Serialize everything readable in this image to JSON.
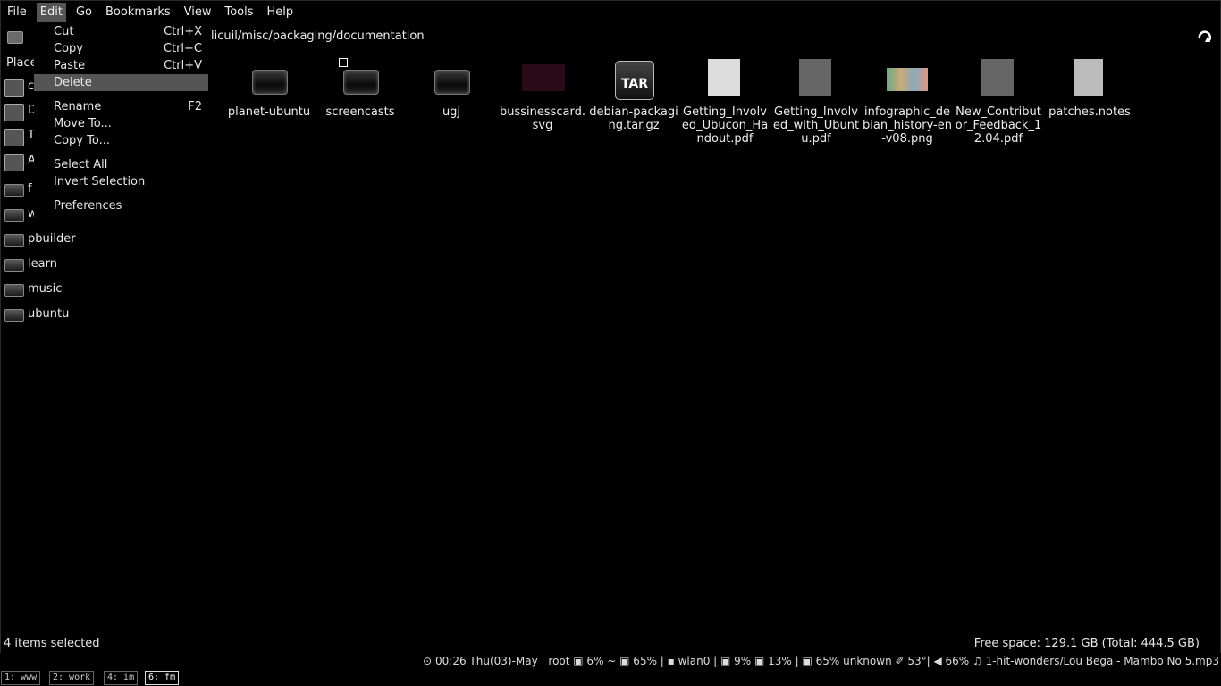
{
  "menubar": {
    "items": [
      "File",
      "Edit",
      "Go",
      "Bookmarks",
      "View",
      "Tools",
      "Help"
    ],
    "active": "Edit"
  },
  "toolbar": {
    "path": "licuil/misc/packaging/documentation"
  },
  "sidebar": {
    "places_label": "Place",
    "partial_items": [
      "c",
      "D",
      "T",
      "A",
      "f"
    ],
    "items": [
      "work",
      "pbuilder",
      "learn",
      "music",
      "ubuntu"
    ]
  },
  "edit_menu": {
    "items": [
      {
        "label": "Cut",
        "accel": "Ctrl+X"
      },
      {
        "label": "Copy",
        "accel": "Ctrl+C"
      },
      {
        "label": "Paste",
        "accel": "Ctrl+V"
      },
      {
        "label": "Delete",
        "accel": ""
      },
      {
        "label": "Rename",
        "accel": "F2"
      },
      {
        "label": "Move To...",
        "accel": ""
      },
      {
        "label": "Copy To...",
        "accel": ""
      },
      {
        "label": "Select All",
        "accel": ""
      },
      {
        "label": "Invert Selection",
        "accel": ""
      },
      {
        "label": "Preferences",
        "accel": ""
      }
    ],
    "selected": "Delete"
  },
  "files": [
    {
      "name": "planet-ubuntu",
      "kind": "folder-icon"
    },
    {
      "name": "screencasts",
      "kind": "folder-icon"
    },
    {
      "name": "ugj",
      "kind": "folder-icon"
    },
    {
      "name": "bussinesscard.svg",
      "kind": "svg-thumbnail-icon"
    },
    {
      "name": "debian-packaging.tar.gz",
      "kind": "tar-archive-icon",
      "badge": "TAR"
    },
    {
      "name": "Getting_Involved_Ubucon_Handout.pdf",
      "kind": "pdf-icon"
    },
    {
      "name": "Getting_Involved_with_Ubuntu.pdf",
      "kind": "pdf-icon"
    },
    {
      "name": "infographic_debian_history-en-v08.png",
      "kind": "png-thumbnail-icon"
    },
    {
      "name": "New_Contributor_Feedback_12.04.pdf",
      "kind": "pdf-icon"
    },
    {
      "name": "patches.notes",
      "kind": "text-file-icon"
    }
  ],
  "status": {
    "selection": "4 items selected",
    "free_space": "Free space: 129.1 GB (Total: 444.5 GB)"
  },
  "panel": {
    "sysinfo": "⊙ 00:26 Thu(03)-May | root ▣ 6% ~ ▣ 65% | ▪ wlan0 | ▣ 9% ▣ 13% | ▣ 65% unknown ✐ 53°| ◀ 66% ♫ 1-hit-wonders/Lou Bega - Mambo No 5.mp3",
    "workspaces": [
      "1: www",
      "2: work",
      "4: im",
      "6: fm"
    ],
    "current_workspace": "6: fm"
  }
}
